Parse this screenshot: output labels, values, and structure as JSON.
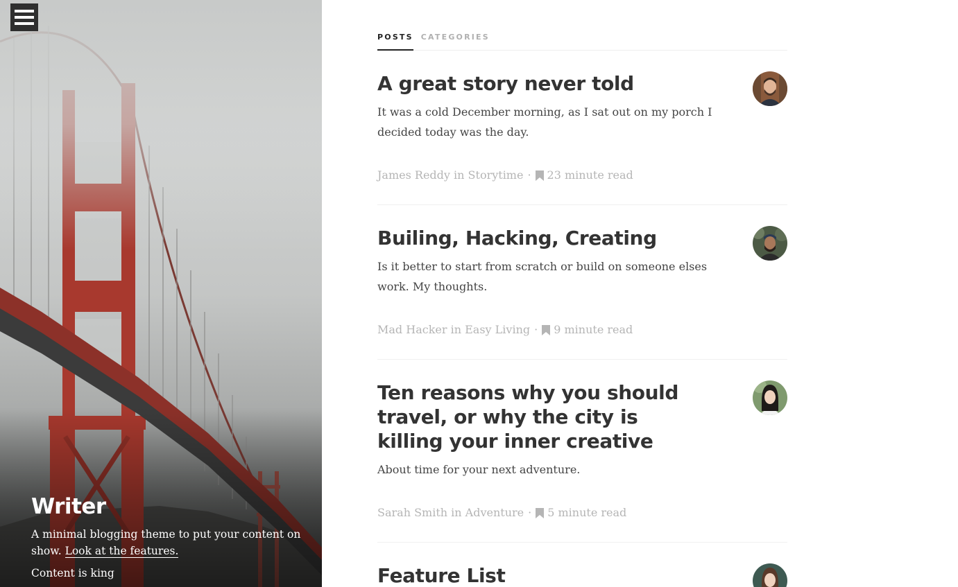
{
  "hero": {
    "menu_icon": "hamburger-menu-icon",
    "site_title": "Writer",
    "description": "A minimal blogging theme to put your content on show.",
    "features_link": "Look at the features.",
    "tagline": "Content is king"
  },
  "tabs": [
    {
      "label": "POSTS",
      "active": true
    },
    {
      "label": "CATEGORIES",
      "active": false
    }
  ],
  "posts": [
    {
      "title": "A great story never told",
      "excerpt": "It was a cold December morning, as I sat out on my porch I decided today was the day.",
      "author": "James Reddy",
      "in_word": "in",
      "category": "Storytime",
      "read_time": "23 minute read"
    },
    {
      "title": "Builing, Hacking, Creating",
      "excerpt": "Is it better to start from scratch or build on someone elses work. My thoughts.",
      "author": "Mad Hacker",
      "in_word": "in",
      "category": "Easy Living",
      "read_time": "9 minute read"
    },
    {
      "title": "Ten reasons why you should travel, or why the city is killing your inner creative",
      "excerpt": "About time for your next adventure.",
      "author": "Sarah Smith",
      "in_word": "in",
      "category": "Adventure",
      "read_time": "5 minute read"
    },
    {
      "title": "Feature List",
      "excerpt": "",
      "author": "",
      "in_word": "",
      "category": "",
      "read_time": ""
    }
  ],
  "meta_separator": "·",
  "colors": {
    "meta_text": "#b5b5b5",
    "title_text": "#333333",
    "bridge_red": "#a8392e"
  }
}
